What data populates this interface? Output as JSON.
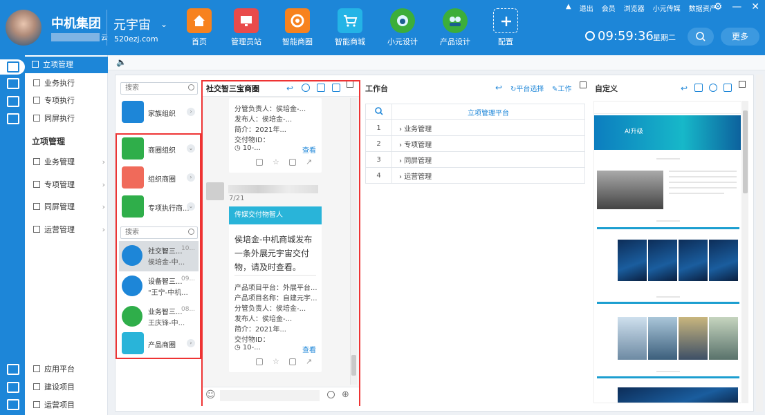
{
  "header": {
    "brand": "中机集团",
    "brand_suffix": "云",
    "platform": "元宇宙",
    "platform_url": "520ezj.com",
    "nav": [
      "首页",
      "管理员站",
      "智能商圈",
      "智能商城",
      "小元设计",
      "产品设计",
      "配置"
    ],
    "system_menu": [
      "退出",
      "会员",
      "浏览器",
      "小元传媒",
      "数据资产"
    ],
    "time": "09:59:36",
    "weekday": "星期二",
    "more": "更多"
  },
  "sidebar": {
    "top_items": [
      "立项管理",
      "业务执行",
      "专项执行",
      "同屏执行"
    ],
    "section_title": "立项管理",
    "group_items": [
      "业务管理",
      "专项管理",
      "同屏管理",
      "运营管理"
    ],
    "bottom_items": [
      "应用平台",
      "建设项目",
      "运营项目"
    ]
  },
  "org_panel": {
    "search_placeholder": "搜索",
    "family": "家族组织",
    "orgs": [
      "商圈组织",
      "组织商圈",
      "专项执行商..."
    ],
    "search2_placeholder": "搜索",
    "chats": [
      {
        "name": "社交智三...",
        "time": "10...",
        "preview": "侯培金-中..."
      },
      {
        "name": "设备智三...",
        "time": "09...",
        "preview": "\"王宁-中机..."
      },
      {
        "name": "业务智三...",
        "time": "08...",
        "preview": "王庆锋-中..."
      }
    ],
    "product": "产品商圈"
  },
  "chat_panel": {
    "title": "社交智三宝商圈",
    "card1": [
      "分管负责人：侯培金-...",
      "发布人：侯培金-...",
      "简介：2021年...",
      "交付物ID：",
      "10-..."
    ],
    "look": "查看",
    "date": "7/21",
    "banner": "传媒交付物智人",
    "message": "侯培金-中机商城发布一条外展元宇宙交付物，请及时查看。",
    "card2": [
      "产品项目平台：外展平台...",
      "产品项目名称：自建元宇...",
      "分管负责人：侯培金-...",
      "发布人：侯培金-...",
      "简介：2021年...",
      "交付物ID：",
      "10-..."
    ]
  },
  "workbench": {
    "title": "工作台",
    "link1": "平台选择",
    "link2": "工作",
    "table_header": "立项管理平台",
    "rows": [
      {
        "idx": "1",
        "name": "业务管理"
      },
      {
        "idx": "2",
        "name": "专项管理"
      },
      {
        "idx": "3",
        "name": "同屏管理"
      },
      {
        "idx": "4",
        "name": "运营管理"
      }
    ]
  },
  "custom": {
    "title": "自定义",
    "hero_text": "AI升级"
  },
  "colors": {
    "primary": "#1d86d8",
    "highlight": "#e33333",
    "banner": "#29b4d9"
  }
}
